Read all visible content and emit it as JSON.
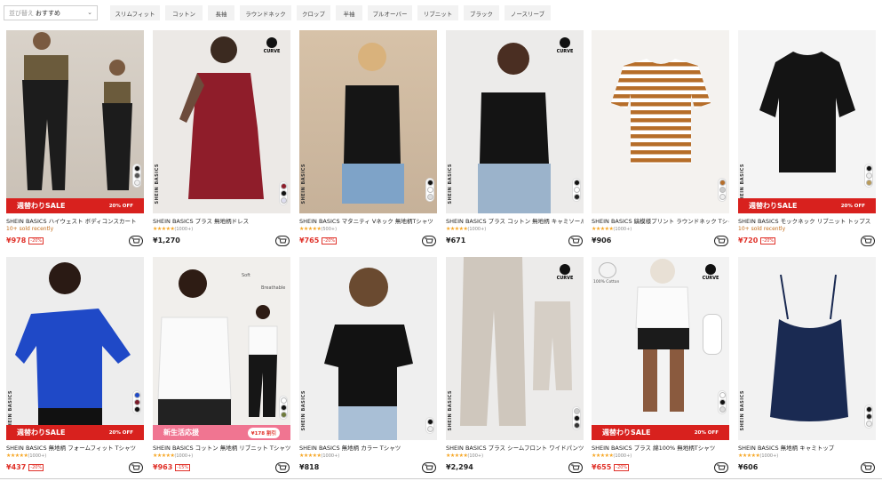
{
  "sort": {
    "label": "並び替え",
    "value": "おすすめ"
  },
  "filters": [
    "スリムフィット",
    "コットン",
    "長袖",
    "ラウンドネック",
    "クロップ",
    "半袖",
    "プルオーバー",
    "リブニット",
    "ブラック",
    "ノースリーブ"
  ],
  "badges": {
    "curve": "CURVE",
    "brand_vertical": "SHEIN BASICS"
  },
  "banners": {
    "sale": "週替わりSALE",
    "off": "20% OFF",
    "new": "新生活応援",
    "price_bubble": "¥178 割引",
    "soft": "Soft",
    "breathable": "Breathable",
    "cotton100": "100% Cotton"
  },
  "products": [
    {
      "title": "SHEIN BASICS ハイウェスト ボディコンスカート",
      "sub": "10+ sold recently",
      "rating": "",
      "price": "¥978",
      "discount": "-20%"
    },
    {
      "title": "SHEIN BASICS プラス 無地柄ドレス",
      "sub": "",
      "rating": "(1000+)",
      "price": "¥1,270",
      "discount": ""
    },
    {
      "title": "SHEIN BASICS マタニティ Vネック 無地柄Tシャツ",
      "sub": "",
      "rating": "(500+)",
      "price": "¥765",
      "discount": "-20%"
    },
    {
      "title": "SHEIN BASICS プラス コットン 無地柄 キャミソール",
      "sub": "",
      "rating": "(1000+)",
      "price": "¥671",
      "discount": ""
    },
    {
      "title": "SHEIN BASICS 縞模様プリント ラウンドネック Tシャツ",
      "sub": "",
      "rating": "(1000+)",
      "price": "¥906",
      "discount": ""
    },
    {
      "title": "SHEIN BASICS モックネック リブニット トップス",
      "sub": "10+ sold recently",
      "rating": "",
      "price": "¥720",
      "discount": "-20%"
    },
    {
      "title": "SHEIN BASICS 無地柄 フォームフィット Tシャツ",
      "sub": "",
      "rating": "(1000+)",
      "price": "¥437",
      "discount": "-20%"
    },
    {
      "title": "SHEIN BASICS コットン 無地柄 リブニット Tシャツ",
      "sub": "",
      "rating": "(1000+)",
      "price": "¥963",
      "discount": "-15%"
    },
    {
      "title": "SHEIN BASICS 無地柄 カラー Tシャツ",
      "sub": "",
      "rating": "(1000+)",
      "price": "¥818",
      "discount": ""
    },
    {
      "title": "SHEIN BASICS プラス シームフロント ワイドパンツ",
      "sub": "",
      "rating": "(100+)",
      "price": "¥2,294",
      "discount": ""
    },
    {
      "title": "SHEIN BASICS プラス 綿100% 無地柄Tシャツ",
      "sub": "",
      "rating": "(1000+)",
      "price": "¥655",
      "discount": "-20%"
    },
    {
      "title": "SHEIN BASICS 無地柄 キャミトップ",
      "sub": "",
      "rating": "(1000+)",
      "price": "¥606",
      "discount": ""
    }
  ],
  "stars": "★★★★★",
  "colors": {
    "sale_red": "#d8211e",
    "accent_pink": "#f07591",
    "star": "#f6a623"
  }
}
